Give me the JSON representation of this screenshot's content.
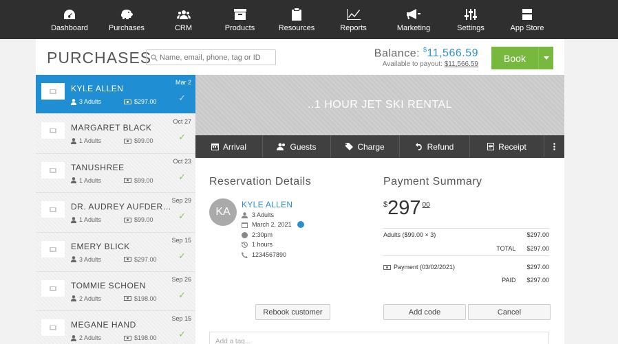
{
  "nav": [
    {
      "label": "Dashboard",
      "icon": "dashboard-icon"
    },
    {
      "label": "Purchases",
      "icon": "piggy-bank-icon"
    },
    {
      "label": "CRM",
      "icon": "people-icon"
    },
    {
      "label": "Products",
      "icon": "archive-box-icon"
    },
    {
      "label": "Resources",
      "icon": "clipboard-icon"
    },
    {
      "label": "Reports",
      "icon": "line-chart-icon"
    },
    {
      "label": "Marketing",
      "icon": "megaphone-icon"
    },
    {
      "label": "Settings",
      "icon": "sliders-icon"
    },
    {
      "label": "App Store",
      "icon": "store-icon"
    }
  ],
  "header": {
    "title": "PURCHASES",
    "search_placeholder": "Name, email, phone, tag or ID",
    "balance_label": "Balance:",
    "balance_currency": "$",
    "balance_amount": "11,566.59",
    "payout_label": "Available to payout:",
    "payout_amount": "$11,566.59",
    "book_label": "Book"
  },
  "customers": [
    {
      "name": "KYLE ALLEN",
      "guests": "3 Adults",
      "price": "$297.00",
      "date": "Mar 2",
      "selected": true
    },
    {
      "name": "MARGARET BLACK",
      "guests": "1 Adults",
      "price": "$99.00",
      "date": "Oct 27"
    },
    {
      "name": "TANUSHREE",
      "guests": "1 Adults",
      "price": "$99.00",
      "date": "Oct 23"
    },
    {
      "name": "DR. AUDREY AUFDERHAR",
      "guests": "1 Adults",
      "price": "$99.00",
      "date": "Sep 29"
    },
    {
      "name": "EMERY BLICK",
      "guests": "3 Adults",
      "price": "$297.00",
      "date": "Sep 15"
    },
    {
      "name": "TOMMIE SCHOEN",
      "guests": "2 Adults",
      "price": "$198.00",
      "date": "Sep 26"
    },
    {
      "name": "MEGANE HAND",
      "guests": "2 Adults",
      "price": "$198.00",
      "date": "Sep 15"
    }
  ],
  "banner": {
    "title": "..1 HOUR JET SKI RENTAL"
  },
  "actions": {
    "arrival": "Arrival",
    "guests": "Guests",
    "charge": "Charge",
    "refund": "Refund",
    "receipt": "Receipt"
  },
  "reservation": {
    "title": "Reservation Details",
    "initials": "KA",
    "name": "KYLE ALLEN",
    "guests": "3 Adults",
    "date": "March 2, 2021",
    "time": "2:30pm",
    "duration": "1 hours",
    "phone": "1234567890",
    "rebook_label": "Rebook customer"
  },
  "payment": {
    "title": "Payment Summary",
    "currency": "$",
    "amount": "297",
    "cents": "00",
    "line_label": "Adults ($99.00 × 3)",
    "line_amount": "$297.00",
    "total_label": "TOTAL",
    "total_amount": "$297.00",
    "payment_label": "Payment (03/02/2021)",
    "payment_amount": "$297.00",
    "paid_label": "PAID",
    "paid_amount": "$297.00",
    "add_code_label": "Add code",
    "cancel_label": "Cancel"
  },
  "tag_placeholder": "Add a tag..."
}
